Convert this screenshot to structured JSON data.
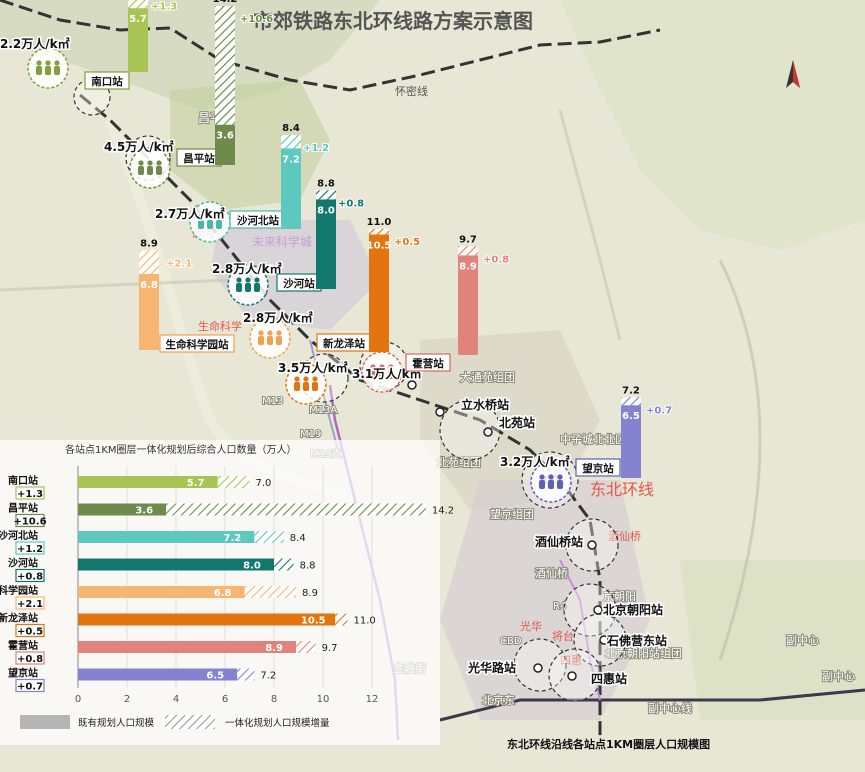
{
  "title": "市郊铁路东北环线路方案示意图",
  "map_labels": {
    "huaimi_line": "怀密线",
    "northeast_loop": "东北环线",
    "future_city": "未来科学城",
    "changping_partial": "昌平",
    "shahe_partial": "沙河",
    "life_sci_partial": "生命科学",
    "datong_group": "大通苑组团",
    "beiyuan_group": "北苑组团",
    "wangjing_group": "望京组团",
    "dongbei_group_partial": "东北组团",
    "dongzicheng": "中子城北北区",
    "jiuxian_park": "酒仙桥",
    "jiuxian_group": "酒仙桥",
    "cbd": "CBD",
    "guanghua_partial": "光华",
    "jinrongjie": "金融街",
    "beijing_east": "北京东",
    "fu_center_1": "副中心",
    "fu_center_2": "副中心",
    "fu_center_line": "副中心线",
    "jiangzhuang": "将台",
    "chaoyang_group": "北京朝阳站组团",
    "siheng_partial": "四惠",
    "m13": "M13",
    "m13a": "M13A",
    "m19": "M19",
    "m19zhi": "M19支",
    "r4": "R4",
    "chaoyang_partial": "京朝阳"
  },
  "stations": {
    "nankou": {
      "name": "南口站",
      "density": "2.2万人/k㎡",
      "existing": "5.7",
      "total": "7.0",
      "increment": "+1.3"
    },
    "changping": {
      "name": "昌平站",
      "density": "4.5万人/k㎡",
      "existing": "3.6",
      "total": "14.2",
      "increment": "+10.6"
    },
    "shahebei": {
      "name": "沙河北站",
      "density": "2.7万人/k㎡",
      "existing": "7.2",
      "total": "8.4",
      "increment": "+1.2"
    },
    "shahe": {
      "name": "沙河站",
      "density": "2.8万人/k㎡",
      "existing": "8.0",
      "total": "8.8",
      "increment": "+0.8"
    },
    "shengming": {
      "name": "生命科学园站",
      "density": "2.8万人/k㎡",
      "existing": "6.8",
      "total": "8.9",
      "increment": "+2.1"
    },
    "xinlongze": {
      "name": "新龙泽站",
      "density": "3.5万人/k㎡",
      "existing": "10.5",
      "total": "11",
      "increment": "+0.5"
    },
    "huoying": {
      "name": "霍营站",
      "density": "3.1万人/k㎡",
      "existing": "8.9",
      "total": "9.7",
      "increment": "+0.8"
    },
    "wangjing": {
      "name": "望京站",
      "density": "3.2万人/k㎡",
      "existing": "6.5",
      "total": "7.2",
      "increment": "+0.7"
    }
  },
  "other_stations": {
    "lishuiqiao": "立水桥站",
    "beiyuan": "北苑站",
    "jiuxianqiao": "酒仙桥站",
    "beijing_chaoyang": "北京朝阳站",
    "shifoying": "石佛营东站",
    "guanghualu": "光华路站",
    "sihui": "四惠站"
  },
  "chart_data": {
    "type": "bar",
    "title": "各站点1KM圈层一体化规划后综合人口数量（万人）",
    "caption": "东北环线沿线各站点1KM圈层人口规模图",
    "categories": [
      "南口站",
      "昌平站",
      "沙河北站",
      "沙河站",
      "生命科学园站",
      "新龙泽站",
      "霍营站",
      "望京站"
    ],
    "series": [
      {
        "name": "既有规划人口规模",
        "values": [
          5.7,
          3.6,
          7.2,
          8.0,
          6.8,
          10.5,
          8.9,
          6.5
        ]
      },
      {
        "name": "一体化规划人口规模增量",
        "values": [
          1.3,
          10.6,
          1.2,
          0.8,
          2.1,
          0.5,
          0.8,
          0.7
        ]
      }
    ],
    "totals": [
      7.0,
      14.2,
      8.4,
      8.8,
      8.9,
      11.0,
      9.7,
      7.2
    ],
    "total_labels": [
      "7.0",
      "14.2",
      "8.4",
      "8.8",
      "8.9",
      "11.0",
      "9.7",
      "7.2"
    ],
    "existing_labels": [
      "5.7",
      "3.6",
      "7.2",
      "8.0",
      "6.8",
      "10.5",
      "8.9",
      "6.5"
    ],
    "increment_labels": [
      "+1.3",
      "+10.6",
      "+1.2",
      "+0.8",
      "+2.1",
      "+0.5",
      "+0.8",
      "+0.7"
    ],
    "xticks": [
      "0",
      "2",
      "4",
      "6",
      "8",
      "10",
      "12"
    ],
    "xlim": [
      0,
      14
    ],
    "colors": [
      "#a8c454",
      "#6f8a4d",
      "#5cc8c0",
      "#12786e",
      "#f7b571",
      "#e3740f",
      "#e0837a",
      "#8383cf"
    ],
    "legend": {
      "existing": "既有规划人口规模",
      "increment": "一体化规划人口规模增量"
    }
  }
}
